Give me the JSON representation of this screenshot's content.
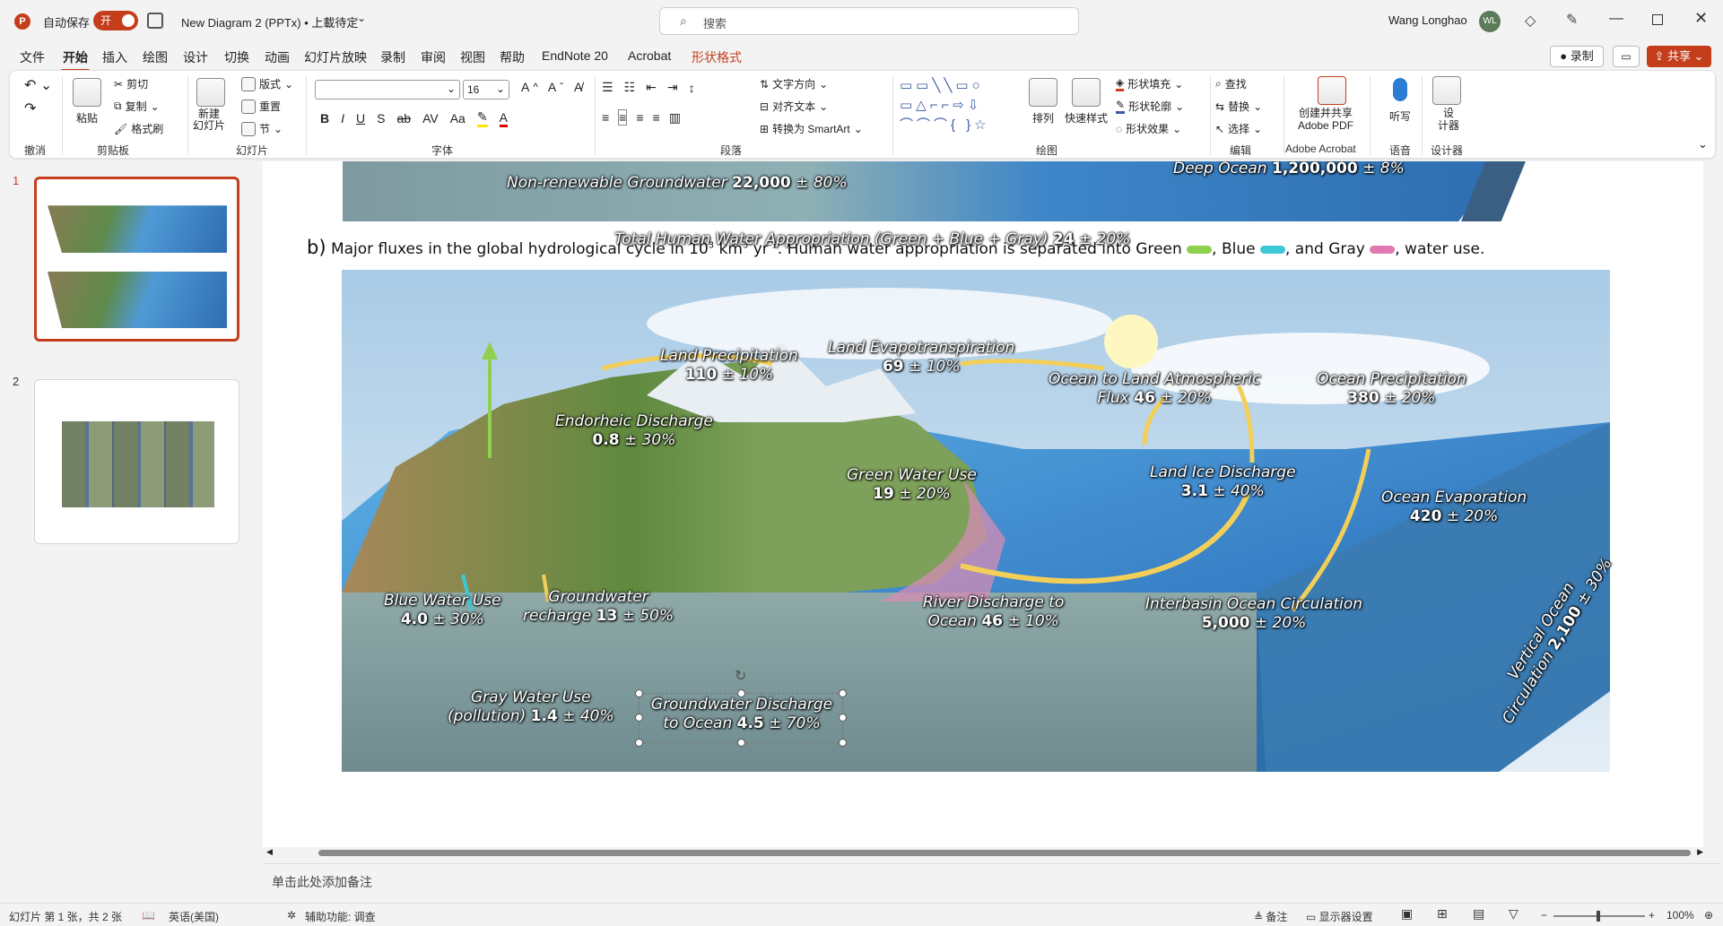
{
  "titlebar": {
    "autosave_label": "自动保存",
    "autosave_state": "开",
    "doc_title": "New Diagram 2 (PPTx) • 上載待定",
    "search_placeholder": "搜索",
    "user_name": "Wang Longhao",
    "user_initials": "WL"
  },
  "tabs": [
    "文件",
    "开始",
    "插入",
    "绘图",
    "设计",
    "切换",
    "动画",
    "幻灯片放映",
    "录制",
    "审阅",
    "视图",
    "帮助",
    "EndNote 20",
    "Acrobat",
    "形状格式"
  ],
  "tab_buttons": {
    "record": "录制",
    "share": "共享"
  },
  "ribbon": {
    "groups": {
      "undo": "撤消",
      "clipboard": "剪贴板",
      "slides": "幻灯片",
      "font": "字体",
      "paragraph": "段落",
      "drawing": "绘图",
      "editing": "编辑",
      "adobe": "Adobe Acrobat",
      "voice": "语音",
      "designer": "设计器"
    },
    "clipboard": {
      "paste": "粘贴",
      "cut": "剪切",
      "copy": "复制",
      "format_painter": "格式刷"
    },
    "slides": {
      "new_slide": "新建\n幻灯片",
      "layout": "版式",
      "reset": "重置",
      "section": "节"
    },
    "font": {
      "font_name": "",
      "font_size": "16"
    },
    "paragraph": {
      "text_direction": "文字方向",
      "align_text": "对齐文本",
      "smartart": "转换为 SmartArt"
    },
    "drawing": {
      "arrange": "排列",
      "quick_styles": "快速样式",
      "fill": "形状填充",
      "outline": "形状轮廓",
      "effects": "形状效果"
    },
    "editing": {
      "find": "查找",
      "replace": "替换",
      "select": "选择"
    },
    "adobe": {
      "create_share": "创建并共享\nAdobe PDF"
    },
    "voice": {
      "dictate": "听写"
    },
    "designer": {
      "designer": "设\n计器"
    }
  },
  "slides_panel": {
    "slide_numbers": [
      "1",
      "2"
    ]
  },
  "slide": {
    "top_labels": {
      "nonrenewable_text": "Non-renewable Groundwater",
      "nonrenewable_value": "22,000",
      "nonrenewable_err": "± 80%",
      "deep_ocean_text": "Deep Ocean",
      "deep_ocean_value": "1,200,000",
      "deep_ocean_err": "± 8%"
    },
    "caption": {
      "letter": "b)",
      "text_1": "Major fluxes in the global hydrological cycle in 10",
      "sup_1": "3",
      "text_2": " km",
      "sup_2": "3",
      "text_3": " yr",
      "sup_3": "-1",
      "text_4": ". Human water appropriation is separated into Green ",
      "text_5": ", Blue ",
      "text_6": ", and Gray ",
      "text_7": ", water use."
    },
    "header_label": {
      "text": "Total Human Water Appropriation (Green + Blue + Gray)",
      "value": "24",
      "err": "± 20%"
    },
    "fluxes": [
      {
        "name": "Land Precipitation",
        "value": "110",
        "err": "± 10%"
      },
      {
        "name": "Land Evapotranspiration",
        "value": "69",
        "err": "± 10%"
      },
      {
        "name": "Ocean to Land Atmospheric",
        "name2": "Flux",
        "value": "46",
        "err": "± 20%"
      },
      {
        "name": "Ocean Precipitation",
        "value": "380",
        "err": "± 20%"
      },
      {
        "name": "Endorheic Discharge",
        "value": "0.8",
        "err": "± 30%"
      },
      {
        "name": "Green Water Use",
        "value": "19",
        "err": "± 20%"
      },
      {
        "name": "Land Ice Discharge",
        "value": "3.1",
        "err": "± 40%"
      },
      {
        "name": "Ocean Evaporation",
        "value": "420",
        "err": "± 20%"
      },
      {
        "name": "Blue Water Use",
        "value": "4.0",
        "err": "± 30%"
      },
      {
        "name": "Groundwater",
        "name2": "recharge",
        "value": "13",
        "err": "± 50%"
      },
      {
        "name": "River Discharge to",
        "name2": "Ocean",
        "value": "46",
        "err": "± 10%"
      },
      {
        "name": "Interbasin Ocean Circulation",
        "value": "5,000",
        "err": "± 20%"
      },
      {
        "name": "Gray Water Use",
        "name2": "(pollution)",
        "value": "1.4",
        "err": "± 40%"
      },
      {
        "name": "Groundwater Discharge",
        "name2": "to Ocean",
        "value": "4.5",
        "err": "± 70%"
      },
      {
        "name": "Vertical Ocean",
        "name2": "Circulation",
        "value": "2,100",
        "err": "± 30%"
      }
    ]
  },
  "notes_placeholder": "单击此处添加备注",
  "statusbar": {
    "slide_info": "幻灯片 第 1 张，共 2 张",
    "language": "英语(美国)",
    "accessibility": "辅助功能: 调查",
    "notes": "备注",
    "display_settings": "显示器设置",
    "zoom": "100%"
  },
  "colors": {
    "accent": "#c43e1c",
    "share_button": "#c43e1c",
    "green_use": "#8fd14f",
    "blue_use": "#3ec7d6",
    "gray_use": "#e07ab0",
    "flux_arrow": "#f3cf5a"
  }
}
